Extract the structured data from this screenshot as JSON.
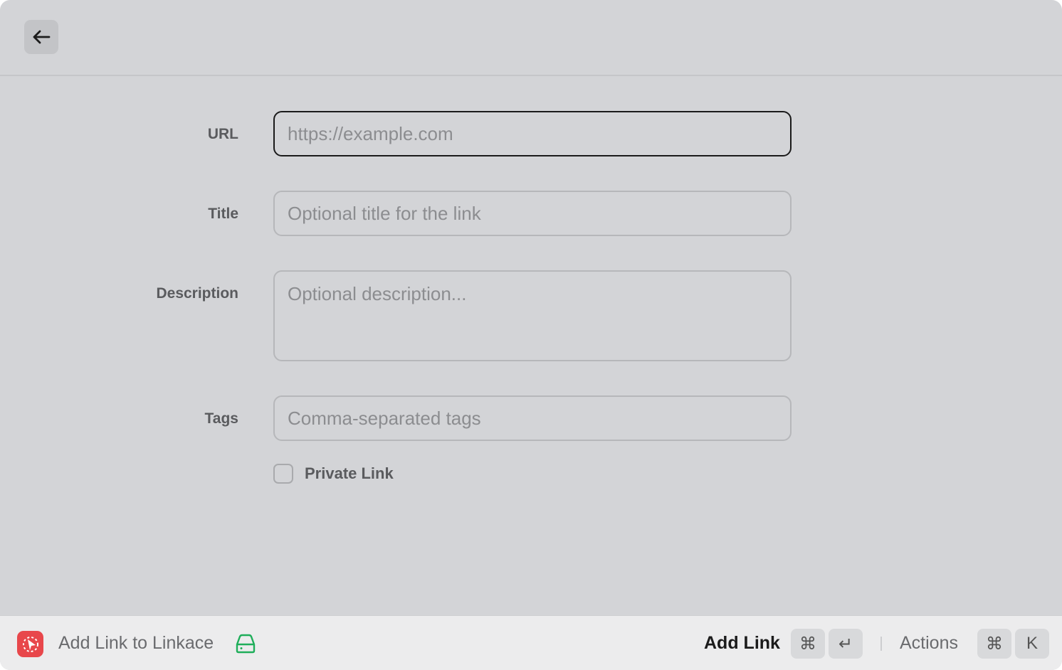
{
  "form": {
    "url": {
      "label": "URL",
      "placeholder": "https://example.com",
      "value": ""
    },
    "title": {
      "label": "Title",
      "placeholder": "Optional title for the link",
      "value": ""
    },
    "description": {
      "label": "Description",
      "placeholder": "Optional description...",
      "value": ""
    },
    "tags": {
      "label": "Tags",
      "placeholder": "Comma-separated tags",
      "value": ""
    },
    "private": {
      "label": "Private Link",
      "checked": false
    }
  },
  "footer": {
    "app_title": "Add Link to Linkace",
    "primary_action": "Add Link",
    "primary_keys": [
      "⌘",
      "↵"
    ],
    "secondary_action": "Actions",
    "secondary_keys": [
      "⌘",
      "K"
    ]
  },
  "icons": {
    "back": "arrow-left-icon",
    "app": "linkace-app-icon",
    "drive": "hard-drive-icon"
  },
  "colors": {
    "app_icon": "#e8474b",
    "drive_icon": "#1fae5a",
    "window_bg": "#d3d4d7",
    "footer_bg": "#ececed"
  }
}
